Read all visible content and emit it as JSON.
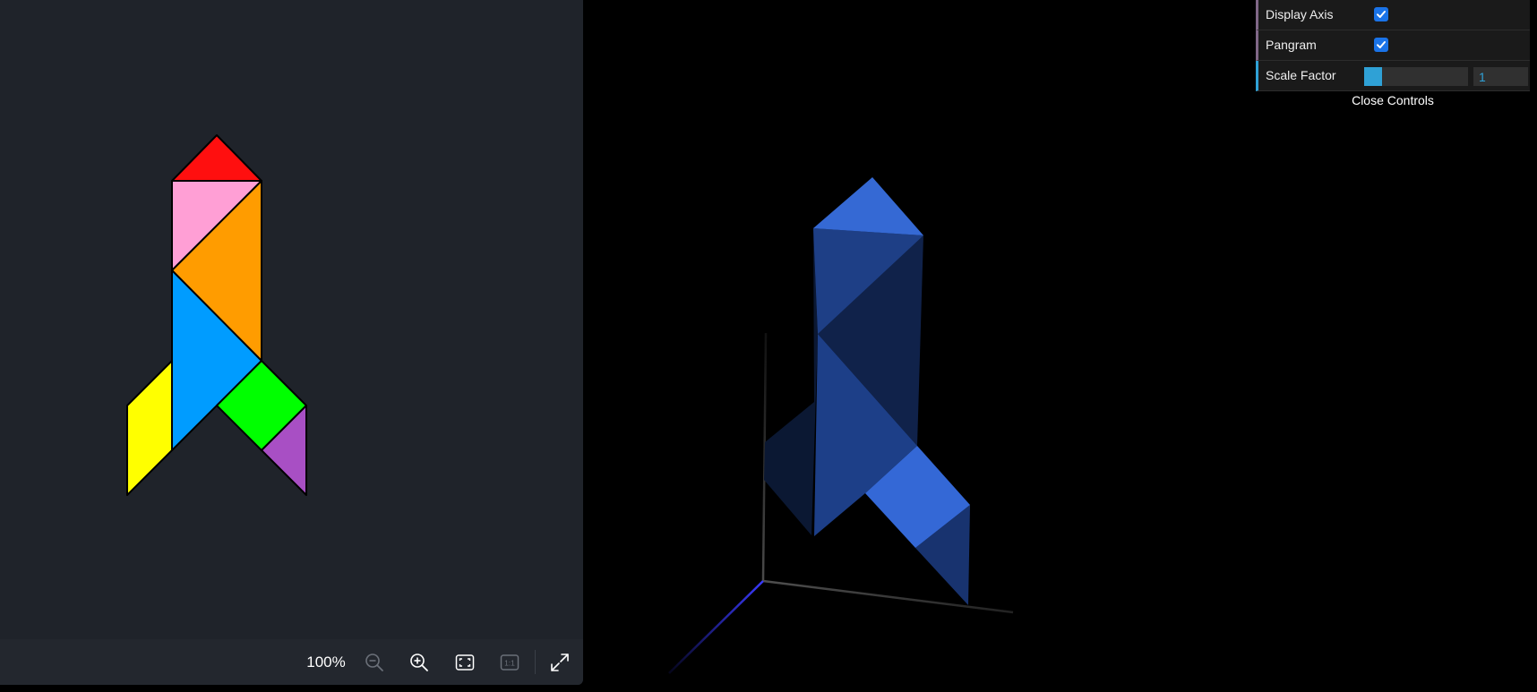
{
  "viewer": {
    "zoom": "100%",
    "icons": [
      "zoom-out-icon",
      "zoom-in-icon",
      "fit-screen-icon",
      "actual-size-icon",
      "fullscreen-icon"
    ],
    "actual_size_label": "1:1",
    "tangram_colors": {
      "top_triangle": "#ff0f0f",
      "pink_triangle": "#ff9fd5",
      "orange_triangle": "#ff9c00",
      "blue_triangle": "#009cff",
      "yellow_parallelogram": "#ffff00",
      "green_square": "#00ff00",
      "purple_triangle": "#a84fc4"
    }
  },
  "scene": {
    "model_color": "#3a6fd8",
    "axis_colors": {
      "x": "#555555",
      "y": "#444444",
      "z": "#3a3aff"
    }
  },
  "gui": {
    "display_axis_label": "Display Axis",
    "display_axis_checked": true,
    "pangram_label": "Pangram",
    "pangram_checked": true,
    "scale_factor_label": "Scale Factor",
    "scale_factor_value": "1",
    "scale_factor_fraction": 0.17,
    "close_label": "Close Controls"
  }
}
